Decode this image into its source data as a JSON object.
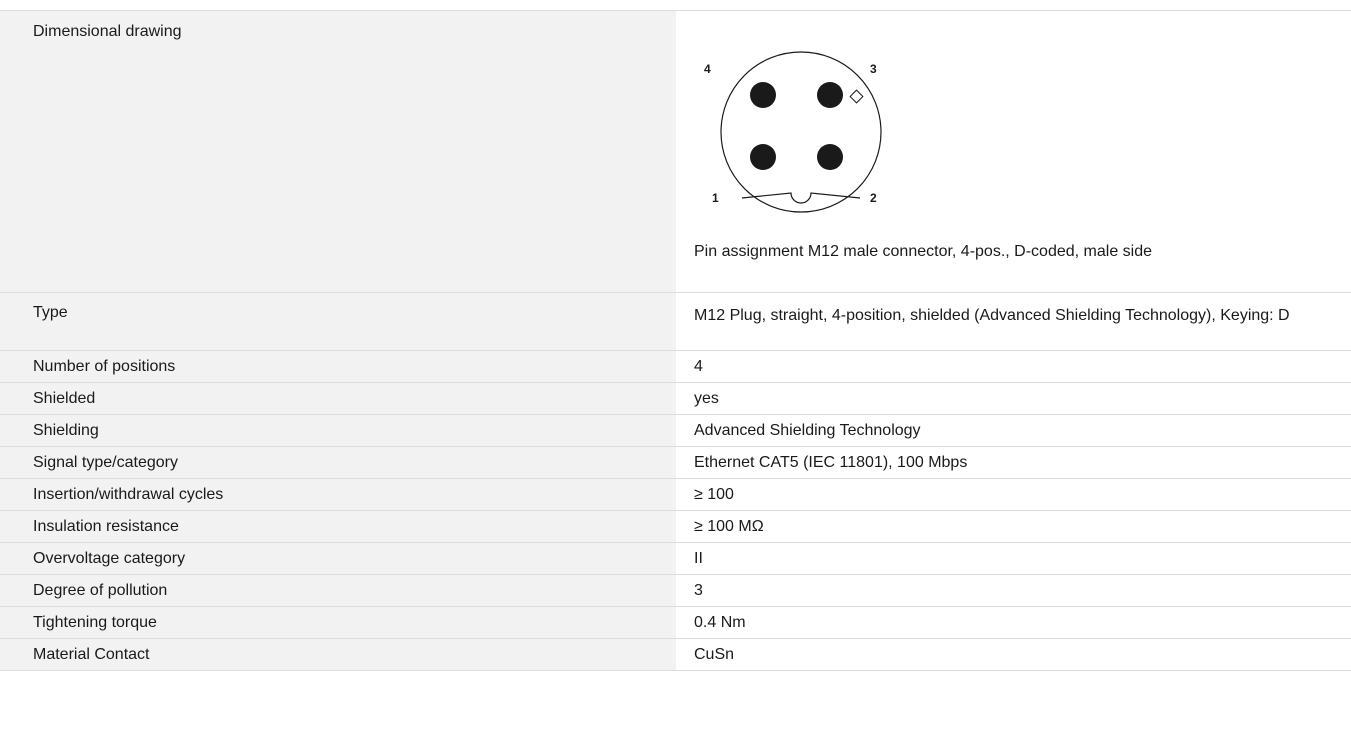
{
  "drawing": {
    "label": "Dimensional drawing",
    "pin_labels": {
      "p1": "1",
      "p2": "2",
      "p3": "3",
      "p4": "4"
    },
    "caption": "Pin assignment M12 male connector, 4-pos., D-coded, male side"
  },
  "specs": [
    {
      "label": "Type",
      "value": "M12 Plug, straight, 4-position, shielded (Advanced Shielding Technology), Keying: D"
    },
    {
      "label": "Number of positions",
      "value": "4"
    },
    {
      "label": "Shielded",
      "value": "yes"
    },
    {
      "label": "Shielding",
      "value": "Advanced Shielding Technology"
    },
    {
      "label": "Signal type/category",
      "value": "Ethernet CAT5 (IEC 11801), 100 Mbps"
    },
    {
      "label": "Insertion/withdrawal cycles",
      "value": "≥ 100"
    },
    {
      "label": "Insulation resistance",
      "value": "≥ 100 MΩ"
    },
    {
      "label": "Overvoltage category",
      "value": "II"
    },
    {
      "label": "Degree of pollution",
      "value": "3"
    },
    {
      "label": "Tightening torque",
      "value": "0.4 Nm"
    },
    {
      "label": "Material Contact",
      "value": "CuSn"
    }
  ],
  "colors": {
    "label_bg": "#f2f2f2",
    "border": "#dcdcdc",
    "text": "#1a1a1a"
  }
}
